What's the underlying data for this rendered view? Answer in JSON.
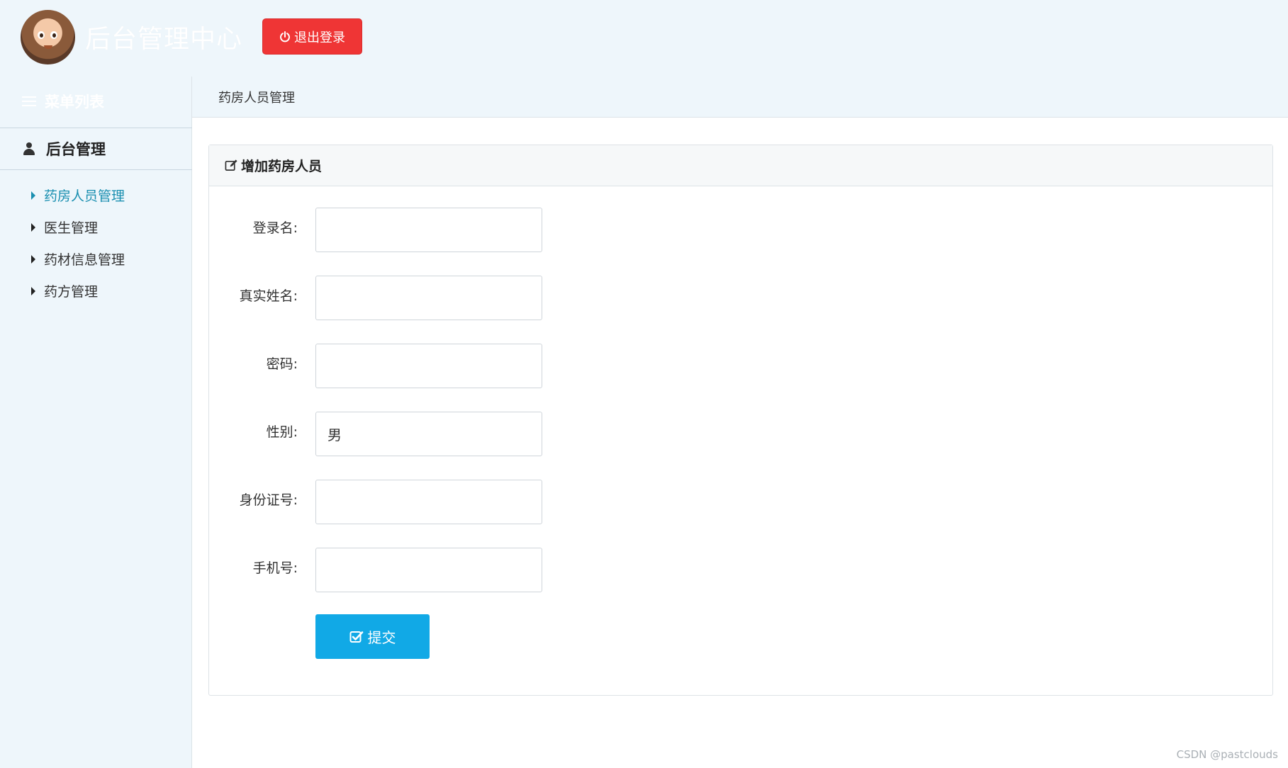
{
  "header": {
    "title": "后台管理中心",
    "logout_label": "退出登录"
  },
  "sidebar": {
    "menu_heading": "菜单列表",
    "group_label": "后台管理",
    "items": [
      {
        "label": "药房人员管理",
        "active": true
      },
      {
        "label": "医生管理"
      },
      {
        "label": "药材信息管理"
      },
      {
        "label": "药方管理"
      }
    ]
  },
  "tabs": [
    {
      "label": "药房人员管理"
    }
  ],
  "form": {
    "title": "增加药房人员",
    "fields": [
      {
        "label": "登录名:",
        "value": ""
      },
      {
        "label": "真实姓名:",
        "value": ""
      },
      {
        "label": "密码:",
        "value": ""
      },
      {
        "label": "性别:",
        "value": "男"
      },
      {
        "label": "身份证号:",
        "value": ""
      },
      {
        "label": "手机号:",
        "value": ""
      }
    ],
    "submit_label": "提交"
  },
  "watermark": "CSDN @pastclouds",
  "colors": {
    "logout": "#ef3535",
    "submit": "#11a9e6",
    "active_nav": "#1a8fb0",
    "background": "#eef6fb"
  },
  "icons": [
    "power-icon",
    "menu-icon",
    "user-icon",
    "caret-right-icon",
    "edit-icon",
    "check-square-icon"
  ]
}
